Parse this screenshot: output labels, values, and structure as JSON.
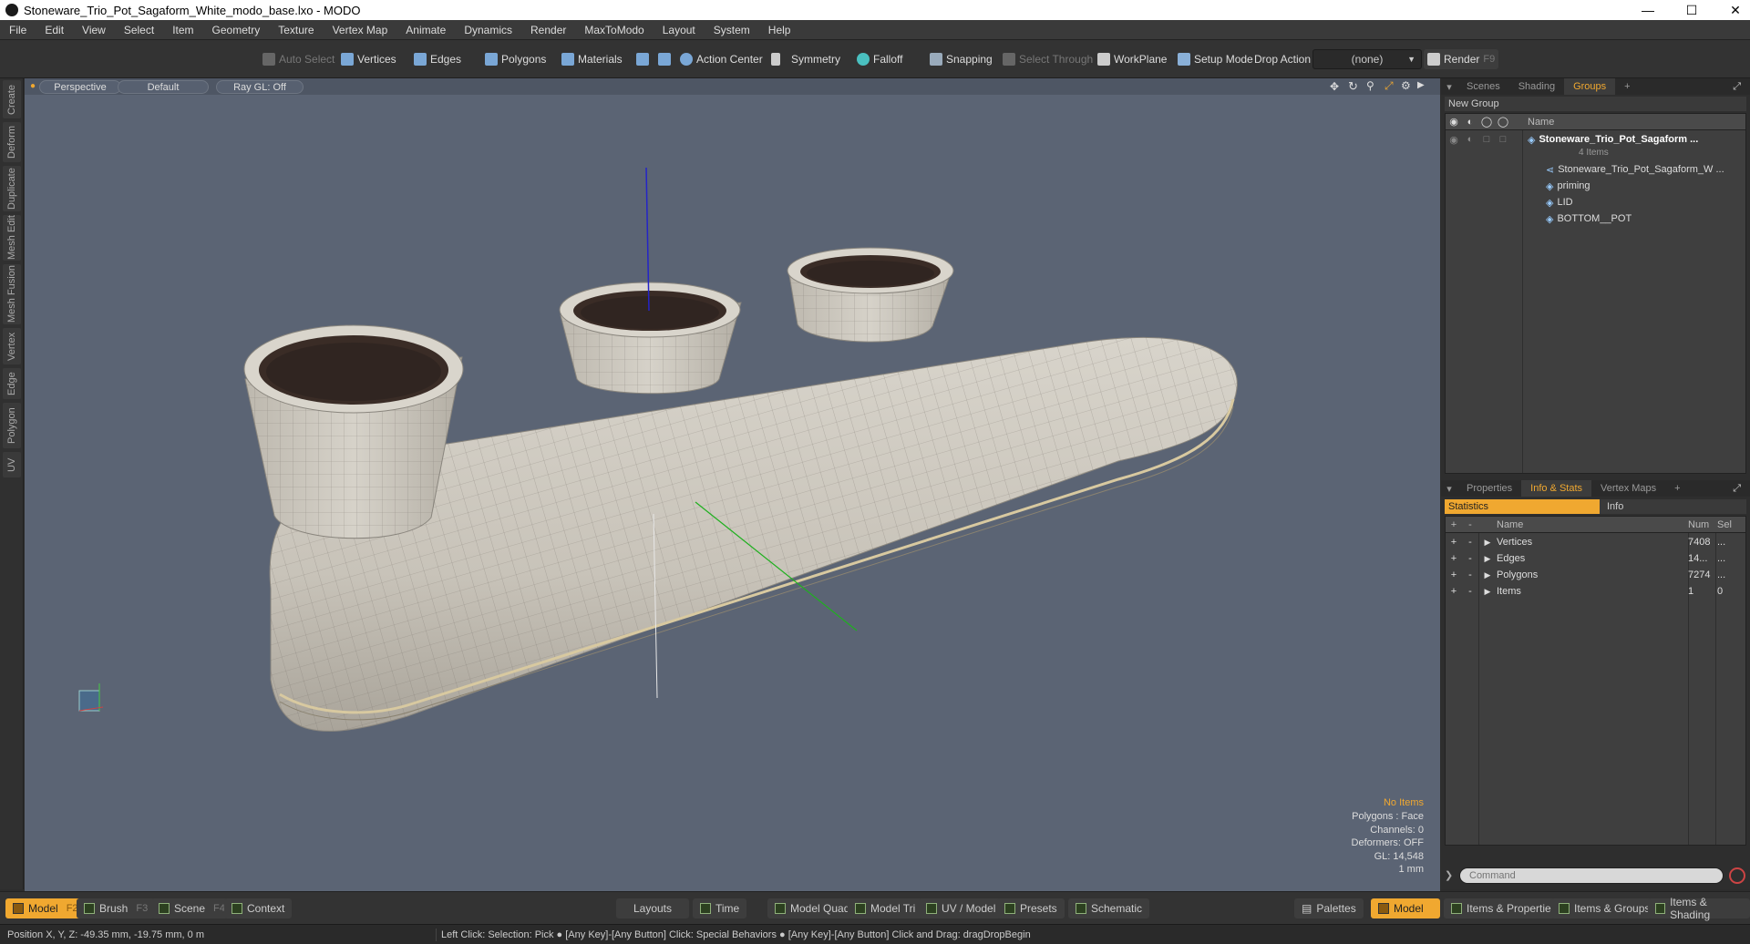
{
  "window": {
    "title": "Stoneware_Trio_Pot_Sagaform_White_modo_base.lxo - MODO"
  },
  "menu": [
    "File",
    "Edit",
    "View",
    "Select",
    "Item",
    "Geometry",
    "Texture",
    "Vertex Map",
    "Animate",
    "Dynamics",
    "Render",
    "MaxToModo",
    "Layout",
    "System",
    "Help"
  ],
  "toolbar": {
    "auto_select": "Auto Select",
    "vertices": "Vertices",
    "edges": "Edges",
    "polygons": "Polygons",
    "materials": "Materials",
    "action_center": "Action Center",
    "symmetry": "Symmetry",
    "falloff": "Falloff",
    "snapping": "Snapping",
    "select_through": "Select Through",
    "workplane": "WorkPlane",
    "setup_mode": "Setup Mode",
    "drop_action": "Drop Action",
    "drop_value": "(none)",
    "render": "Render",
    "render_key": "F9"
  },
  "side_tabs": [
    "Create",
    "Deform",
    "Duplicate",
    "Mesh Edit",
    "Mesh Fusion",
    "Vertex",
    "Edge",
    "Polygon",
    "UV"
  ],
  "viewport": {
    "view": "Perspective",
    "style": "Default",
    "raygl": "Ray GL: Off",
    "stats": {
      "items": "No Items",
      "polygons": "Polygons : Face",
      "channels": "Channels: 0",
      "deformers": "Deformers: OFF",
      "gl": "GL: 14,548",
      "scale": "1 mm"
    }
  },
  "groups_panel": {
    "tabs": [
      "Scenes",
      "Shading",
      "Groups"
    ],
    "active": "Groups",
    "new_group": "New Group",
    "name_header": "Name",
    "root": {
      "name": "Stoneware_Trio_Pot_Sagaform ...",
      "count": "4 Items"
    },
    "children": [
      "Stoneware_Trio_Pot_Sagaform_W ...",
      "priming",
      "LID",
      "BOTTOM__POT"
    ]
  },
  "stats_panel": {
    "tabs": [
      "Properties",
      "Info & Stats",
      "Vertex Maps"
    ],
    "active": "Info & Stats",
    "sub_tabs": [
      "Statistics",
      "Info"
    ],
    "headers": {
      "name": "Name",
      "num": "Num",
      "sel": "Sel"
    },
    "rows": [
      {
        "name": "Vertices",
        "num": "7408",
        "sel": "..."
      },
      {
        "name": "Edges",
        "num": "14...",
        "sel": "..."
      },
      {
        "name": "Polygons",
        "num": "7274",
        "sel": "..."
      },
      {
        "name": "Items",
        "num": "1",
        "sel": "0"
      }
    ],
    "command_placeholder": "Command"
  },
  "bottom": {
    "model": "Model",
    "model_key": "F2",
    "brush": "Brush",
    "brush_key": "F3",
    "scene": "Scene",
    "scene_key": "F4",
    "context": "Context",
    "layouts": "Layouts",
    "time": "Time",
    "model_quad": "Model Quad",
    "model_tri": "Model Tri",
    "uv_model": "UV / Model",
    "presets": "Presets",
    "schematic": "Schematic",
    "palettes": "Palettes",
    "model2": "Model",
    "items_props": "Items & Properties",
    "items_groups": "Items & Groups",
    "items_shading": "Items & Shading"
  },
  "status": {
    "position": "Position X, Y, Z:   -49.35 mm, -19.75 mm, 0 m",
    "hint": "Left Click: Selection: Pick ●  [Any Key]-[Any Button] Click: Special Behaviors ●  [Any Key]-[Any Button] Click and Drag: dragDropBegin"
  }
}
